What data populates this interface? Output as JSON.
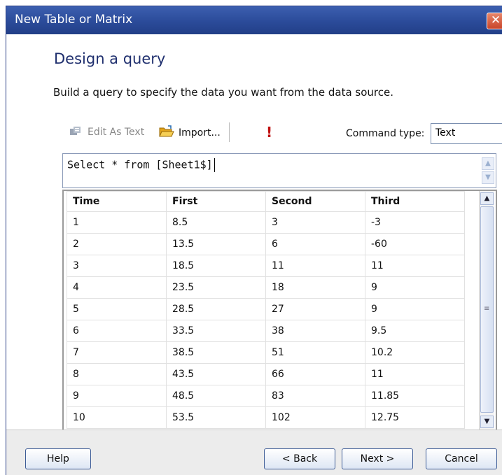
{
  "window": {
    "title": "New Table or Matrix",
    "close_glyph": "✕"
  },
  "page": {
    "heading": "Design a query",
    "subtitle": "Build a query to specify the data you want from the data source."
  },
  "toolbar": {
    "edit_as_text": "Edit As Text",
    "import": "Import...",
    "run_glyph": "!",
    "command_type_label": "Command type:",
    "command_type_value": "Text"
  },
  "query": {
    "text": "Select * from [Sheet1$]"
  },
  "results": {
    "columns": [
      "Time",
      "First",
      "Second",
      "Third"
    ],
    "rows": [
      [
        "1",
        "8.5",
        "3",
        "-3"
      ],
      [
        "2",
        "13.5",
        "6",
        "-60"
      ],
      [
        "3",
        "18.5",
        "11",
        "11"
      ],
      [
        "4",
        "23.5",
        "18",
        "9"
      ],
      [
        "5",
        "28.5",
        "27",
        "9"
      ],
      [
        "6",
        "33.5",
        "38",
        "9.5"
      ],
      [
        "7",
        "38.5",
        "51",
        "10.2"
      ],
      [
        "8",
        "43.5",
        "66",
        "11"
      ],
      [
        "9",
        "48.5",
        "83",
        "11.85"
      ],
      [
        "10",
        "53.5",
        "102",
        "12.75"
      ]
    ]
  },
  "buttons": {
    "help": "Help",
    "back": "< Back",
    "next": "Next >",
    "cancel": "Cancel"
  },
  "icons": {
    "edit_as_text": "edit-as-text-icon",
    "import": "folder-open-icon",
    "run": "run-query-icon",
    "close": "close-icon"
  },
  "colors": {
    "title_bar": "#2b4b9a",
    "heading": "#1f2f6e",
    "run_icon": "#c01010"
  }
}
